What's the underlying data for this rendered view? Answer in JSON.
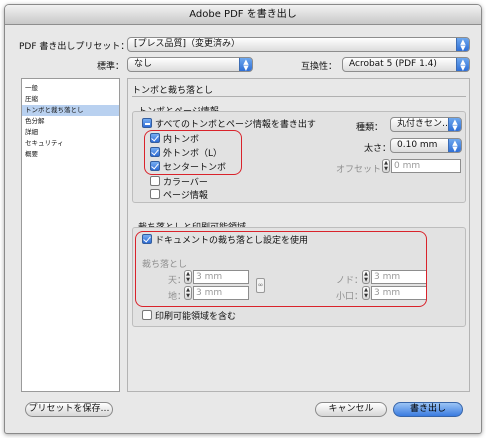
{
  "window": {
    "title": "Adobe PDF を書き出し"
  },
  "preset": {
    "label": "PDF 書き出しプリセット：",
    "value": "[プレス品質]（変更済み）"
  },
  "standard": {
    "label": "標準：",
    "value": "なし"
  },
  "compatibility": {
    "label": "互換性：",
    "value": "Acrobat 5 (PDF 1.4)"
  },
  "sidebar": {
    "items": [
      {
        "label": "一般"
      },
      {
        "label": "圧縮"
      },
      {
        "label": "トンボと裁ち落とし"
      },
      {
        "label": "色分解"
      },
      {
        "label": "詳細"
      },
      {
        "label": "セキュリティ"
      },
      {
        "label": "概要"
      }
    ]
  },
  "panel": {
    "title": "トンボと裁ち落とし"
  },
  "marks": {
    "group_title": "トンボとページ情報",
    "all_marks_label": "すべてのトンボとページ情報を書き出す",
    "crop_marks_label": "内トンボ",
    "trim_marks_label": "外トンボ（L）",
    "registration_marks_label": "センタートンボ",
    "color_bars_label": "カラーバー",
    "page_info_label": "ページ情報",
    "type_label": "種類：",
    "type_value": "丸付きセン…",
    "weight_label": "太さ：",
    "weight_value": "0.10 mm",
    "offset_label": "オフセット：",
    "offset_value": "0 mm"
  },
  "bleed": {
    "group_title": "裁ち落としと印刷可能領域",
    "use_document_label": "ドキュメントの裁ち落とし設定を使用",
    "bleed_label": "裁ち落とし",
    "top_label": "天：",
    "top_value": "3 mm",
    "bottom_label": "地：",
    "bottom_value": "3 mm",
    "inside_label": "ノド：",
    "inside_value": "3 mm",
    "outside_label": "小口：",
    "outside_value": "3 mm",
    "slug_label": "印刷可能領域を含む"
  },
  "footer": {
    "save_preset": "プリセットを保存…",
    "cancel": "キャンセル",
    "export": "書き出し"
  },
  "colors": {
    "accent": "#2f6fd6",
    "highlight_box": "#d9232b",
    "selection": "#b9d1f0"
  }
}
